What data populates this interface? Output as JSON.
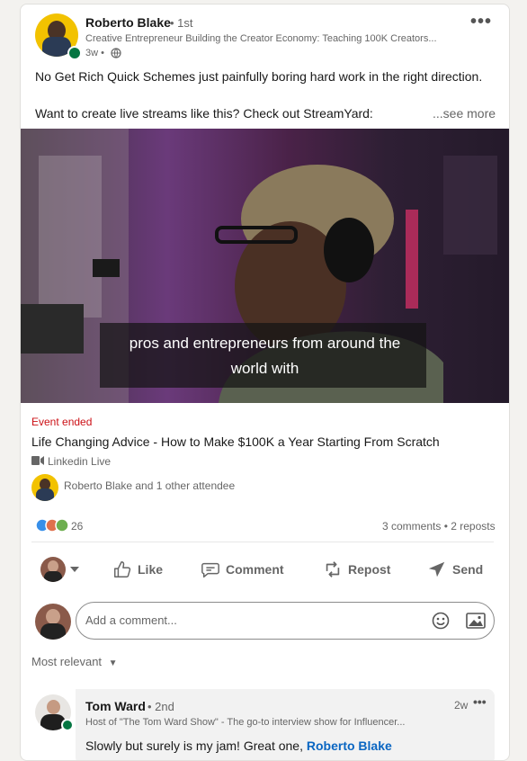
{
  "post": {
    "author": {
      "name": "Roberto Blake",
      "degree": "• 1st",
      "headline": "Creative Entrepreneur Building the Creator Economy: Teaching 100K Creators...",
      "time": "3w •"
    },
    "more_label": "•••",
    "text_line1": "No Get Rich Quick Schemes just painfully boring hard work in the right direction.",
    "text_line2": "Want to create live streams like this? Check out StreamYard:",
    "see_more": "...see more"
  },
  "video": {
    "caption_line1": "pros and entrepreneurs from around the",
    "caption_line2": "world with"
  },
  "event": {
    "status": "Event ended",
    "title": "Life Changing Advice - How to Make $100K a Year Starting From Scratch",
    "type": "Linkedin Live",
    "attendees": "Roberto Blake and 1 other attendee"
  },
  "social": {
    "reactions": "26",
    "stats": "3 comments • 2 reposts"
  },
  "actions": {
    "like": "Like",
    "comment": "Comment",
    "repost": "Repost",
    "send": "Send"
  },
  "comment_input": {
    "placeholder": "Add a comment..."
  },
  "sort": {
    "label": "Most relevant"
  },
  "comment": {
    "author": "Tom Ward",
    "degree": "• 2nd",
    "headline": "Host of \"The Tom Ward Show\" - The go-to interview show for Influencer...",
    "time": "2w",
    "more": "•••",
    "text": "Slowly but surely is my jam! Great one,",
    "mention": "Roberto Blake"
  },
  "colors": {
    "link": "#0a66c2",
    "event_ended": "#cc1016",
    "online": "#057642"
  }
}
